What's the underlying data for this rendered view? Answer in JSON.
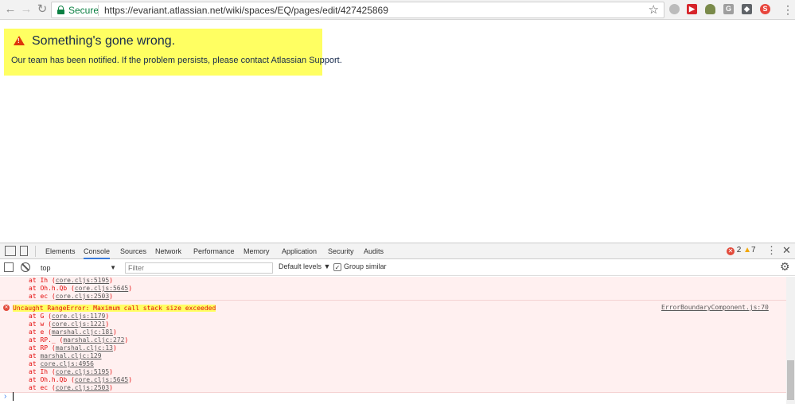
{
  "browser": {
    "security_label": "Secure",
    "url": "https://evariant.atlassian.net/wiki/spaces/EQ/pages/edit/427425869",
    "menu_dots": "⋮"
  },
  "error": {
    "title": "Something's gone wrong.",
    "message": "Our team has been notified. If the problem persists, please contact Atlassian Support."
  },
  "devtools": {
    "tabs": [
      "Elements",
      "Console",
      "Sources",
      "Network",
      "Performance",
      "Memory",
      "Application",
      "Security",
      "Audits"
    ],
    "active_tab": "Console",
    "error_count": "2",
    "warning_count": "7",
    "context": "top",
    "filter_placeholder": "Filter",
    "levels_label": "Default levels ▼",
    "group_similar_label": "Group similar",
    "group_similar_checked": "✓"
  },
  "console": {
    "prev_stack": [
      {
        "text": "at Ih (",
        "link": "core.cljs:5195",
        "end": ")"
      },
      {
        "text": "at Oh.h.Qb (",
        "link": "core.cljs:5645",
        "end": ")"
      },
      {
        "text": "at ec (",
        "link": "core.cljs:2503",
        "end": ")"
      }
    ],
    "error_head": "Uncaught RangeError: Maximum call stack size exceeded",
    "error_source": "ErrorBoundaryComponent.js:70",
    "stack": [
      {
        "text": "at G (",
        "link": "core.cljs:1179",
        "end": ")"
      },
      {
        "text": "at w (",
        "link": "core.cljs:1221",
        "end": ")"
      },
      {
        "text": "at e (",
        "link": "marshal.cljc:181",
        "end": ")"
      },
      {
        "text": "at RP._ (",
        "link": "marshal.cljc:272",
        "end": ")"
      },
      {
        "text": "at RP (",
        "link": "marshal.cljc:13",
        "end": ")"
      },
      {
        "text": "at ",
        "link": "marshal.cljc:129",
        "end": ""
      },
      {
        "text": "at ",
        "link": "core.cljs:4956",
        "end": ""
      },
      {
        "text": "at Ih (",
        "link": "core.cljs:5195",
        "end": ")"
      },
      {
        "text": "at Oh.h.Qb (",
        "link": "core.cljs:5645",
        "end": ")"
      },
      {
        "text": "at ec (",
        "link": "core.cljs:2503",
        "end": ")"
      }
    ]
  }
}
